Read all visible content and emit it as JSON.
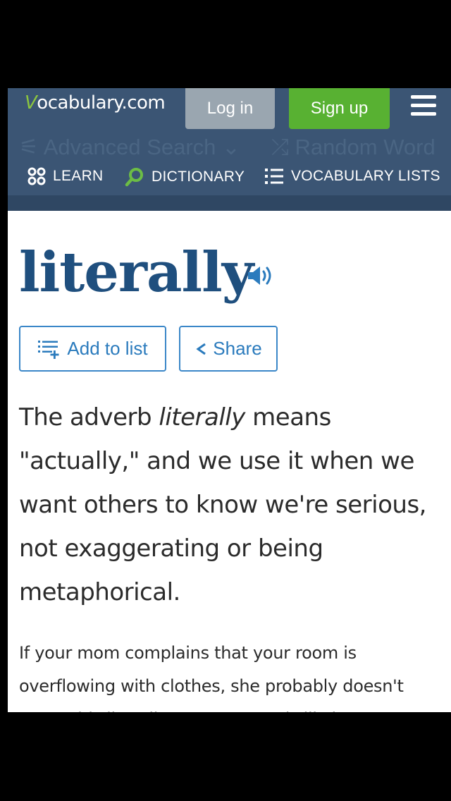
{
  "header": {
    "logo_mark": "V",
    "logo_text": "ocabulary.com",
    "login_label": "Log in",
    "signup_label": "Sign up",
    "advanced_search_label": "Advanced Search",
    "random_word_label": "Random Word"
  },
  "nav": {
    "items": [
      {
        "label": "LEARN",
        "icon": "learn-circles-icon"
      },
      {
        "label": "DICTIONARY",
        "icon": "search-icon"
      },
      {
        "label": "VOCABULARY LISTS",
        "icon": "list-icon"
      }
    ]
  },
  "entry": {
    "word": "literally",
    "add_to_list_label": "Add to list",
    "share_label": "Share",
    "short_def_before": "The adverb ",
    "short_def_italic": "literally",
    "short_def_after": " means \"actually,\" and we use it when we want others to know we're serious, not exaggerating or being metaphorical.",
    "long_def": "If your mom complains that your room is overflowing with clothes, she probably doesn't mean this literally — your room is likely"
  },
  "colors": {
    "header_bg": "#3b5574",
    "signup_green": "#58b132",
    "word_blue": "#1f4f7e",
    "link_blue": "#2b7bbd"
  }
}
